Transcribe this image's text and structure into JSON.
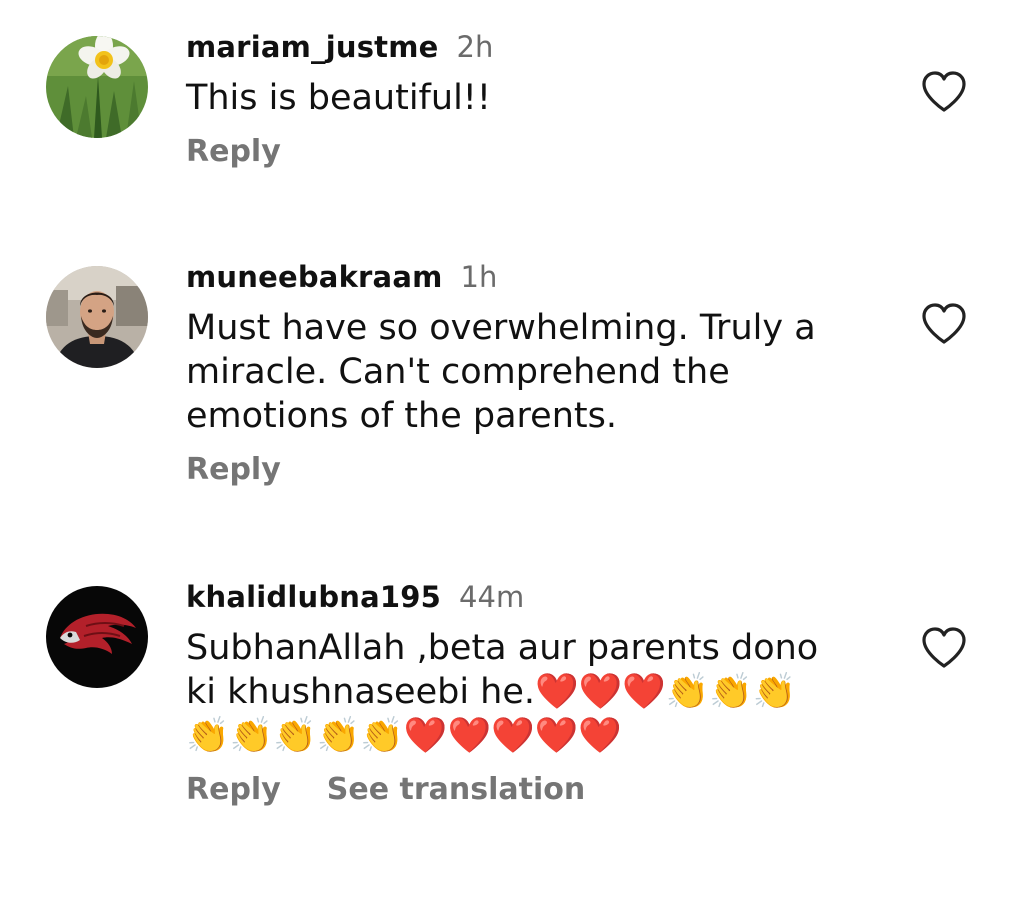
{
  "comments": [
    {
      "username": "mariam_justme",
      "time": "2h",
      "text": "This is beautiful!!",
      "reply_label": "Reply",
      "avatar": "daffodil-flower-avatar"
    },
    {
      "username": "muneebakraam",
      "time": "1h",
      "text": "Must have so overwhelming. Truly a\nmiracle. Can't comprehend the\nemotions of the parents.",
      "reply_label": "Reply",
      "avatar": "man-portrait-avatar"
    },
    {
      "username": "khalidlubna195",
      "time": "44m",
      "text": "SubhanAllah ,beta aur parents dono\nki khushnaseebi he.❤️❤️❤️👏👏👏\n👏👏👏👏👏❤️❤️❤️❤️❤️",
      "reply_label": "Reply",
      "translation_label": "See translation",
      "avatar": "red-eagle-logo-avatar"
    }
  ],
  "icons": {
    "like": "heart-outline-icon"
  },
  "colors": {
    "text": "#111111",
    "muted": "#757575",
    "timestamp": "#6b6b6b",
    "background": "#ffffff"
  }
}
